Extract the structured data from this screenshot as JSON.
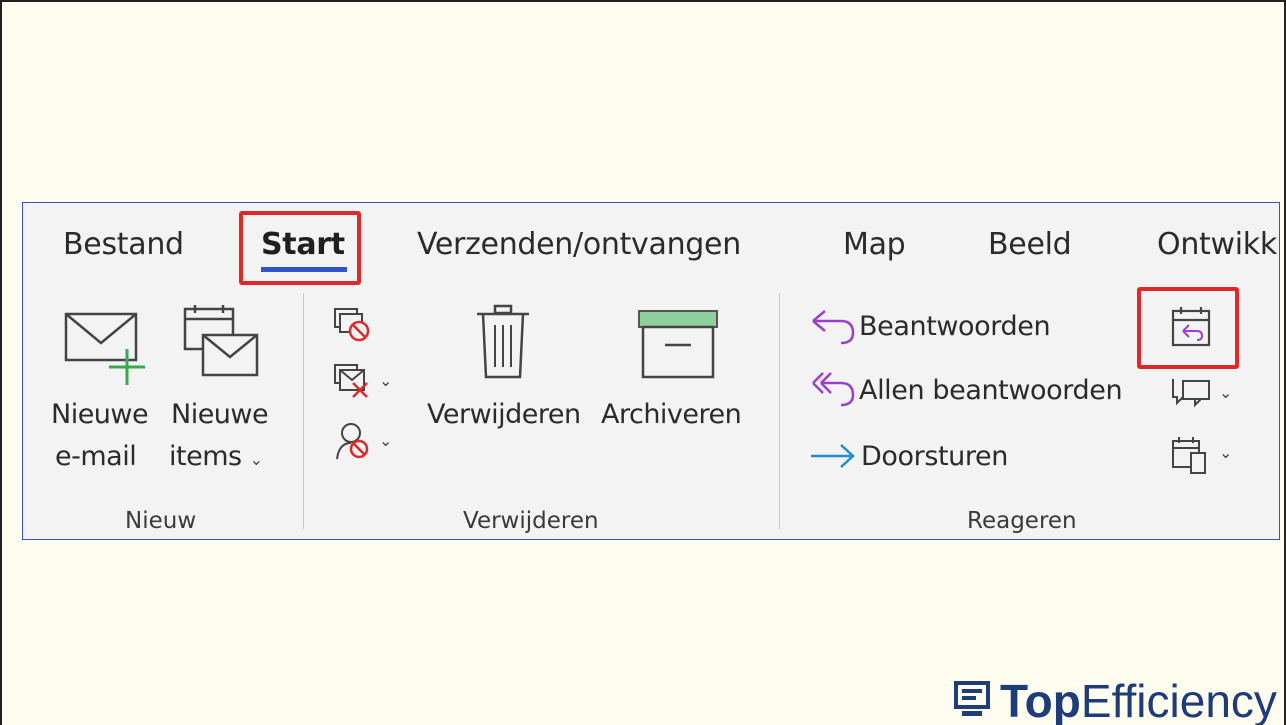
{
  "tabs": {
    "bestand": "Bestand",
    "start": "Start",
    "verzenden": "Verzenden/ontvangen",
    "map": "Map",
    "beeld": "Beeld",
    "ontwikk": "Ontwikk"
  },
  "nieuw": {
    "new_email_line1": "Nieuwe",
    "new_email_line2": "e-mail",
    "new_items_line1": "Nieuwe",
    "new_items_line2": "items",
    "group_label": "Nieuw"
  },
  "verwijderen": {
    "delete_label": "Verwijderen",
    "archive_label": "Archiveren",
    "group_label": "Verwijderen"
  },
  "reageren": {
    "reply_label": "Beantwoorden",
    "reply_all_label": "Allen beantwoorden",
    "forward_label": "Doorsturen",
    "group_label": "Reageren"
  },
  "branding": {
    "brand_bold": "Top",
    "brand_regular": "Efficiency"
  },
  "colors": {
    "highlight": "#e0282a",
    "accent": "#2f55c9",
    "reply_purple": "#9b3fd0",
    "forward_blue": "#1f8ed6",
    "archive_green": "#8fd19e"
  }
}
